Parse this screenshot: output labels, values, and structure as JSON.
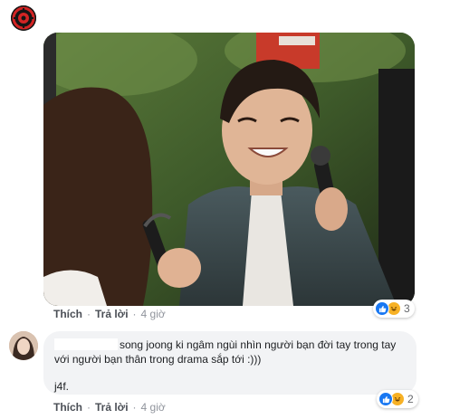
{
  "post": {
    "reactions": {
      "count": "3",
      "icons": [
        "like-icon",
        "haha-icon"
      ]
    },
    "actions": {
      "like": "Thích",
      "reply": "Trả lời",
      "time": "4 giờ"
    }
  },
  "comment": {
    "text_line": "song joong ki ngâm ngùi nhìn người bạn đời tay trong tay với người bạn thân trong drama sắp tới :)))",
    "signature": "j4f.",
    "reactions": {
      "count": "2",
      "icons": [
        "like-icon",
        "haha-icon"
      ]
    },
    "actions": {
      "like": "Thích",
      "reply": "Trả lời",
      "time": "4 giờ"
    }
  },
  "colors": {
    "like_blue": "#1877f2",
    "haha_yellow": "#f7b125",
    "bubble_bg": "#f2f3f5",
    "action_text": "#4b4f56",
    "meta_text": "#90949c"
  }
}
